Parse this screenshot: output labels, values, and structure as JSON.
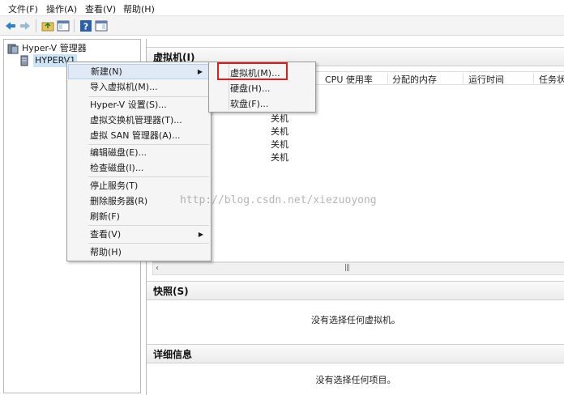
{
  "menubar": {
    "file": "文件(F)",
    "action": "操作(A)",
    "view": "查看(V)",
    "help": "帮助(H)"
  },
  "tree": {
    "root": "Hyper-V 管理器",
    "host": "HYPERV1"
  },
  "vm_section": {
    "title": "虚拟机(I)",
    "columns": [
      "CPU 使用率",
      "分配的内存",
      "运行时间",
      "任务状"
    ],
    "states": [
      "关机",
      "关机",
      "关机",
      "关机"
    ]
  },
  "snapshot_section": {
    "title": "快照(S)",
    "empty": "没有选择任何虚拟机。"
  },
  "details_section": {
    "title": "详细信息",
    "empty": "没有选择任何项目。"
  },
  "context_menu": {
    "new": "新建(N)",
    "import_vm": "导入虚拟机(M)...",
    "hyperv_settings": "Hyper-V 设置(S)...",
    "vswitch_manager": "虚拟交换机管理器(T)...",
    "vsan_manager": "虚拟 SAN 管理器(A)...",
    "edit_disk": "编辑磁盘(E)...",
    "inspect_disk": "检查磁盘(I)...",
    "stop_service": "停止服务(T)",
    "remove_server": "删除服务器(R)",
    "refresh": "刷新(F)",
    "view": "查看(V)",
    "help": "帮助(H)"
  },
  "submenu": {
    "vm": "虚拟机(M)...",
    "hard_disk": "硬盘(H)...",
    "floppy": "软盘(F)..."
  },
  "watermark": "http://blog.csdn.net/xiezuoyong",
  "colors": {
    "highlight_box": "#d81e1e",
    "selected_host_bg": "#cde4f7"
  }
}
